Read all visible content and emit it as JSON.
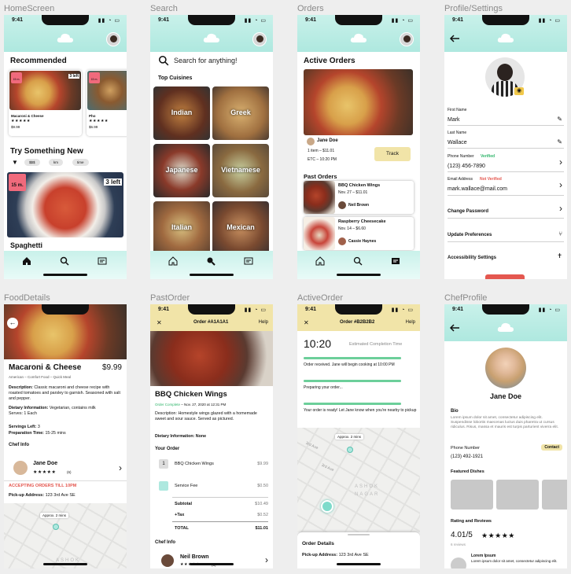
{
  "frames": {
    "home": "HomeScreen",
    "search": "Search",
    "orders": "Orders",
    "profile": "Profile/Settings",
    "food": "FoodDetails",
    "past": "PastOrder",
    "active": "ActiveOrder",
    "chef": "ChefProfile"
  },
  "time": "9:41",
  "home": {
    "recommended": "Recommended",
    "card1": {
      "badge": "15 m.",
      "left": "3 left",
      "name": "Macaroni & Cheese",
      "stars": "★★★★★",
      "price": "$9.99"
    },
    "card2": {
      "badge": "15 m.",
      "name": "Pho",
      "stars": "★★★★★",
      "price": "$6.99"
    },
    "try": "Try Something New",
    "filters": [
      "$$$",
      "km",
      "time"
    ],
    "big": {
      "badge": "15 m.",
      "left": "3 left",
      "name": "Spaghetti"
    }
  },
  "search": {
    "placeholder": "Search for anything!",
    "top": "Top Cuisines",
    "cuisines": [
      "Indian",
      "Greek",
      "Japanese",
      "Vietnamese",
      "Italian",
      "Mexican"
    ]
  },
  "orders": {
    "active": "Active Orders",
    "chef": "Jane Doe",
    "items": "1 item – $11.01",
    "etc": "ETC – 10:20 PM",
    "track": "Track",
    "past": "Past Orders",
    "p1": {
      "name": "BBQ Chicken Wings",
      "date": "Nov. 27 – $11.01",
      "chef": "Neil Brown"
    },
    "p2": {
      "name": "Raspberry Cheesecake",
      "date": "Nov. 14 – $6.60",
      "chef": "Cassie Haynes"
    }
  },
  "profile": {
    "first_label": "First Name",
    "first": "Mark",
    "last_label": "Last Name",
    "last": "Wallace",
    "phone_label": "Phone Number",
    "verified": "Verified",
    "phone": "(123) 456-7890",
    "email_label": "Email Address",
    "not_verified": "Not Verified",
    "email": "mark.wallace@mail.com",
    "change_pw": "Change Password",
    "prefs": "Update Preferences",
    "access": "Accessibility Settings"
  },
  "food": {
    "name": "Macaroni & Cheese",
    "price": "$9.99",
    "sub": "American – Comfort Food – Quick Meal",
    "desc_label": "Description:",
    "desc": "Classic macaroni and cheese recipe with roasted tomatoes and parsley to garnish. Seasoned with salt and pepper.",
    "diet_label": "Dietary Information:",
    "diet": "Vegetarian, contains milk",
    "serves": "Serves: 1 Each",
    "servings_label": "Servings Left:",
    "servings": "3",
    "prep_label": "Preparation Time:",
    "prep": "15-25 mins",
    "chef_info": "Chef Info",
    "chef": "Jane Doe",
    "rating_count": "(6)",
    "accepting": "ACCEPTING ORDERS TILL 10PM",
    "pickup_label": "Pick-up Address:",
    "pickup": "123 3rd Ave SE",
    "approx": "Approx. 2 mins",
    "ashok": "ASHOK"
  },
  "past": {
    "order": "Order #A1A1A1",
    "help": "Help",
    "name": "BBQ Chicken Wings",
    "complete": "Order Complete",
    "date": " – Nov. 27, 2020 at 12:31 PM",
    "desc_label": "Description:",
    "desc": "Homestyle wings glazed with a homemade sweet and sour sauce. Served as pictured.",
    "diet": "Dietary Information: None",
    "your_order": "Your Order",
    "row1": {
      "qty": "1",
      "name": "BBQ Chicken Wings",
      "price": "$9.99"
    },
    "row2": {
      "name": "Service Fee",
      "price": "$0.50"
    },
    "subtotal_label": "Subtotal",
    "subtotal": "$10.49",
    "tax_label": "+Tax",
    "tax": "$0.52",
    "total_label": "TOTAL",
    "total": "$11.01",
    "chef_info": "Chef Info",
    "chef": "Neil Brown",
    "rating_count": "(3)"
  },
  "active": {
    "order": "Order #B2B2B2",
    "help": "Help",
    "time": "10:20",
    "est": "Estimated Completion Time",
    "step1": "Order received. Jane will begin cooking at 10:00 PM",
    "step2": "Preparing your order...",
    "step3": "Your order is ready! Let Jane know when you're nearby to pickup",
    "approx": "Approx. 2 mins",
    "street1": "3rd Ave",
    "street2": "3rd Ave",
    "ashok": "ASHOK",
    "nagar": "NAGAR",
    "details": "Order Details",
    "pickup_label": "Pick-up Address:",
    "pickup": "123 3rd Ave SE"
  },
  "chef": {
    "name": "Jane Doe",
    "bio_label": "Bio",
    "bio": "Lorem ipsum dolor sit amet, consectetur adipiscing elit. Suspendisse lobortis maecenas luctus duis pharetra ut cursus ridiculus. Risus, massa et mauris est turpis parturient viverra elit.",
    "phone_label": "Phone Number",
    "contact": "Contact",
    "phone": "(123) 492-1921",
    "featured": "Featured Dishes",
    "ratings": "Rating and Reviews",
    "score": "4.01/5",
    "stars": "★★★★★",
    "reviews": "6 reviews",
    "rev_name": "Lorem Ipsum",
    "rev_text": "Lorem ipsum dolor sit amet, consectetur adipiscing elit."
  },
  "colors": {
    "mint": "#aee8df",
    "cream": "#f1e4a8",
    "green": "#2fb56a",
    "red": "#e4574f",
    "badge": "#f06a7c"
  }
}
